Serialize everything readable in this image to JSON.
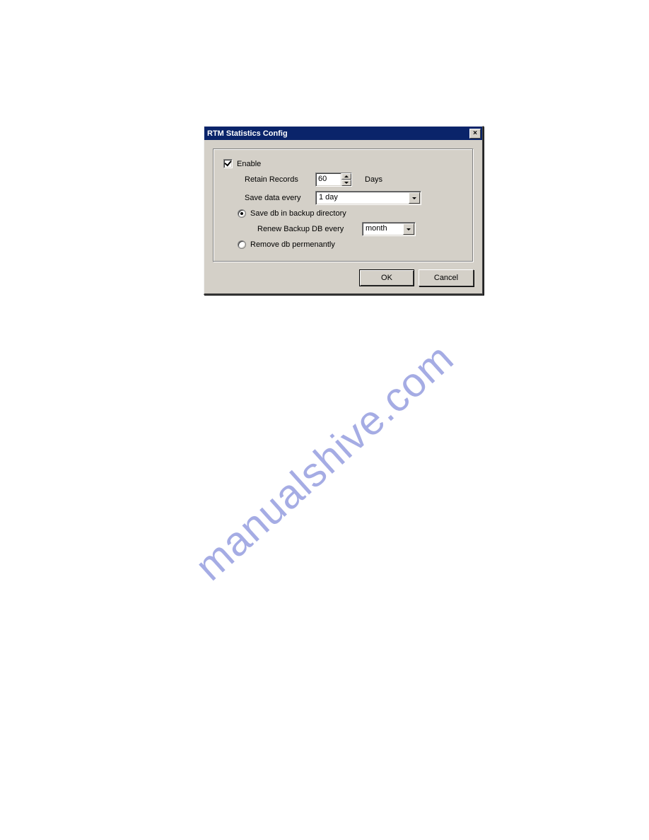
{
  "dialog": {
    "title": "RTM Statistics Config",
    "enable_label": "Enable",
    "enable_checked": true,
    "retain_label": "Retain Records",
    "retain_value": "60",
    "retain_unit": "Days",
    "save_every_label": "Save data every",
    "save_every_value": "1 day",
    "radio_save_backup_label": "Save db in backup directory",
    "radio_save_backup_selected": true,
    "renew_label": "Renew Backup DB every",
    "renew_value": "month",
    "radio_remove_label": "Remove db permenantly",
    "radio_remove_selected": false,
    "ok_label": "OK",
    "cancel_label": "Cancel"
  },
  "watermark": "manualshive.com"
}
